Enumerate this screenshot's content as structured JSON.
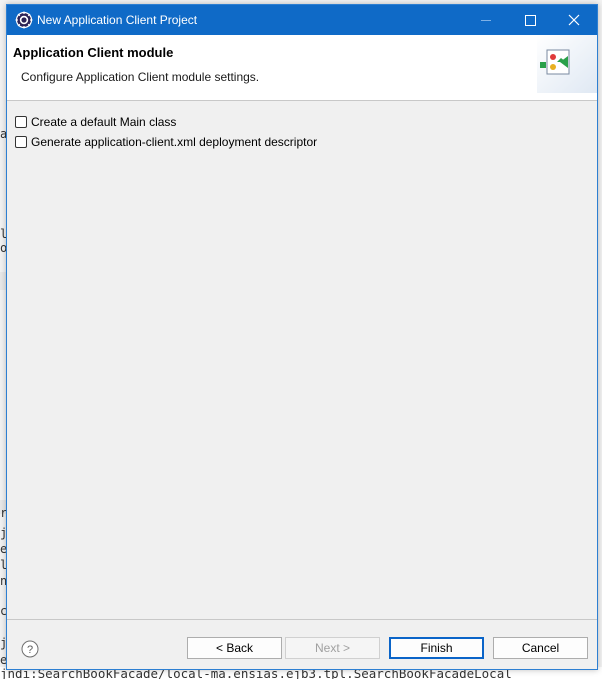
{
  "window": {
    "title": "New Application Client Project"
  },
  "banner": {
    "title": "Application Client module",
    "description": "Configure Application Client module settings."
  },
  "options": [
    {
      "label": "Create a default Main class",
      "checked": false
    },
    {
      "label": "Generate application-client.xml deployment descriptor",
      "checked": false
    }
  ],
  "buttons": {
    "back": "< Back",
    "next": "Next >",
    "finish": "Finish",
    "cancel": "Cancel"
  },
  "background": {
    "left_fragments": [
      "a",
      "l",
      "o",
      "r",
      "je",
      "e",
      "l",
      "n",
      "c",
      "j",
      "e",
      "j"
    ],
    "bottom_text": "jndi:SearchBookFacade/local-ma.ensias.ejb3.tpl.SearchBookFacadeLocal"
  },
  "colors": {
    "titlebar": "#0f6ac7",
    "accent_button_border": "#0a64c8",
    "dialog_bg": "#f0f0f0"
  },
  "icons": [
    "eclipse-icon",
    "minimize-icon",
    "maximize-icon",
    "close-icon",
    "wizard-banner-icon",
    "help-icon"
  ]
}
